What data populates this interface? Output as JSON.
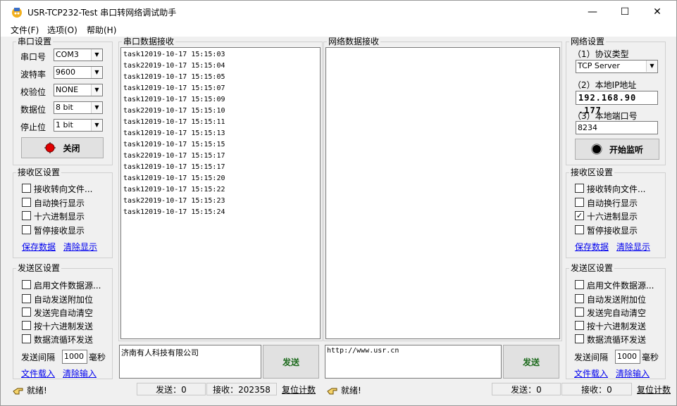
{
  "window": {
    "title": "USR-TCP232-Test 串口转网络调试助手",
    "minimize_glyph": "—",
    "maximize_glyph": "☐",
    "close_glyph": "✕"
  },
  "menu": {
    "file": "文件(F)",
    "options": "选项(O)",
    "help": "帮助(H)"
  },
  "serial_settings": {
    "title": "串口设置",
    "port_label": "串口号",
    "port_value": "COM3",
    "baud_label": "波特率",
    "baud_value": "9600",
    "parity_label": "校验位",
    "parity_value": "NONE",
    "databits_label": "数据位",
    "databits_value": "8 bit",
    "stopbits_label": "停止位",
    "stopbits_value": "1 bit",
    "close_button": "关闭"
  },
  "left_receive": {
    "title": "接收区设置",
    "opt1": "接收转向文件...",
    "opt2": "自动换行显示",
    "opt3": "十六进制显示",
    "opt4": "暂停接收显示",
    "save": "保存数据",
    "clear": "清除显示"
  },
  "left_send": {
    "title": "发送区设置",
    "opt1": "启用文件数据源...",
    "opt2": "自动发送附加位",
    "opt3": "发送完自动清空",
    "opt4": "按十六进制发送",
    "opt5": "数据流循环发送",
    "interval_label": "发送间隔",
    "interval_value": "1000",
    "interval_unit": "毫秒",
    "load": "文件载入",
    "clear": "清除输入"
  },
  "serial_recv": {
    "title": "串口数据接收",
    "lines": [
      "task12019-10-17 15:15:03",
      "task22019-10-17 15:15:04",
      "task12019-10-17 15:15:05",
      "task12019-10-17 15:15:07",
      "task12019-10-17 15:15:09",
      "task22019-10-17 15:15:10",
      "task12019-10-17 15:15:11",
      "task12019-10-17 15:15:13",
      "task12019-10-17 15:15:15",
      "task22019-10-17 15:15:17",
      "task12019-10-17 15:15:17",
      "task12019-10-17 15:15:20",
      "task12019-10-17 15:15:22",
      "task22019-10-17 15:15:23",
      "task12019-10-17 15:15:24"
    ],
    "send_text": "济南有人科技有限公司",
    "send_button": "发送"
  },
  "net_recv": {
    "title": "网络数据接收",
    "send_text": "http://www.usr.cn",
    "send_button": "发送"
  },
  "net_settings": {
    "title": "网络设置",
    "protocol_label": "（1）协议类型",
    "protocol_value": "TCP Server",
    "ip_label": "（2）本地IP地址",
    "ip_value": "192.168.90 .177",
    "port_label": "（3）本地端口号",
    "port_value": "8234",
    "listen_button": "开始监听"
  },
  "right_receive": {
    "title": "接收区设置",
    "opt1": "接收转向文件...",
    "opt2": "自动换行显示",
    "opt3": "十六进制显示",
    "opt3_checked": "✓",
    "opt4": "暂停接收显示",
    "save": "保存数据",
    "clear": "清除显示"
  },
  "right_send": {
    "title": "发送区设置",
    "opt1": "启用文件数据源...",
    "opt2": "自动发送附加位",
    "opt3": "发送完自动清空",
    "opt4": "按十六进制发送",
    "opt5": "数据流循环发送",
    "interval_label": "发送间隔",
    "interval_value": "1000",
    "interval_unit": "毫秒",
    "load": "文件载入",
    "clear": "清除输入"
  },
  "status_left": {
    "ready": "就绪!",
    "sent": "发送：0",
    "received": "接收：202358",
    "reset": "复位计数"
  },
  "status_right": {
    "ready": "就绪!",
    "sent": "发送：0",
    "received": "接收：0",
    "reset": "复位计数"
  },
  "colors": {
    "accent_red": "#e00000",
    "link_blue": "#0000ee"
  }
}
